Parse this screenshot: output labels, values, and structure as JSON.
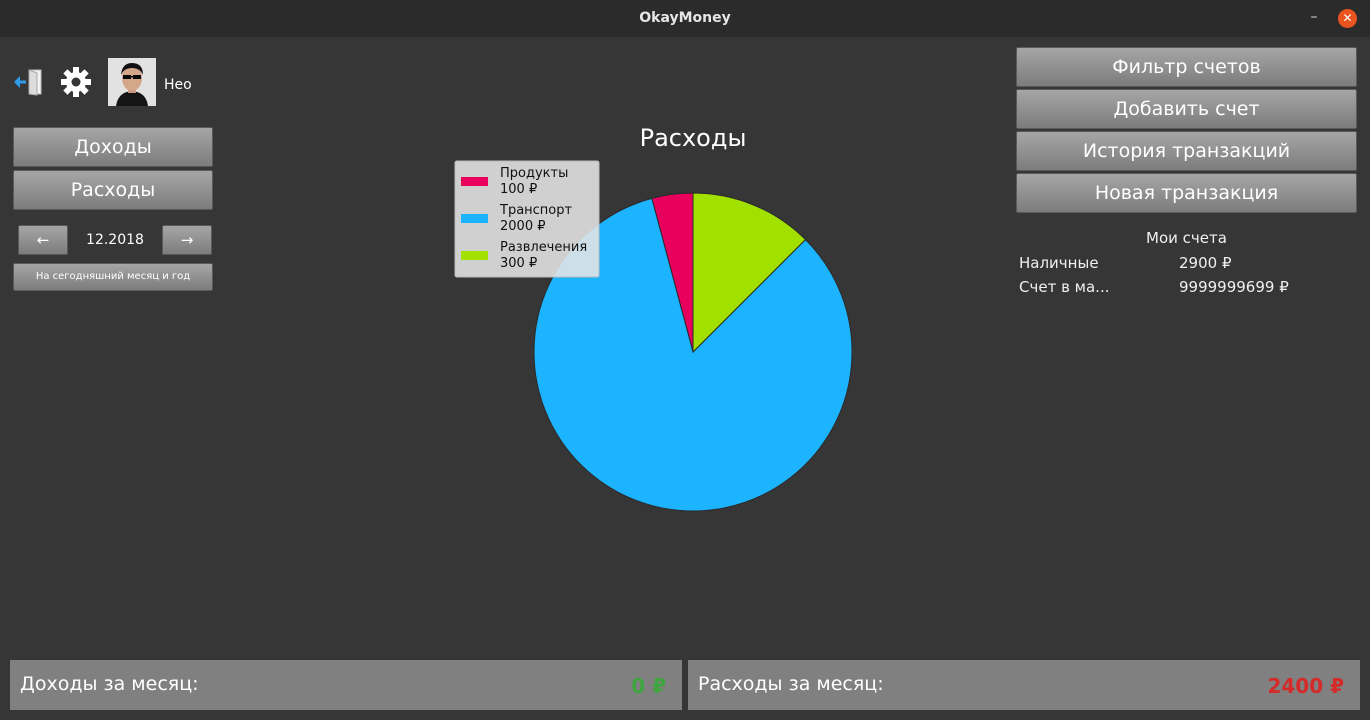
{
  "window": {
    "title": "OkayMoney",
    "minimize_glyph": "–",
    "close_glyph": "✕"
  },
  "user": {
    "name": "Нео",
    "avatar": "avatar-photo"
  },
  "icons": {
    "exit": "exit-door-icon",
    "settings": "gear-icon"
  },
  "left_nav": {
    "income_label": "Доходы",
    "expenses_label": "Расходы",
    "prev_label": "←",
    "next_label": "→",
    "period": "12.2018",
    "current_month_label": "На сегодняшний месяц и год"
  },
  "right_actions": {
    "filter_label": "Фильтр счетов",
    "add_account_label": "Добавить счет",
    "history_label": "История транзакций",
    "new_transaction_label": "Новая транзакция"
  },
  "accounts": {
    "heading": "Мои счета",
    "items": [
      {
        "name": "Наличные",
        "balance": "2900 ₽"
      },
      {
        "name": "Счет в ма...",
        "balance": "9999999699 ₽"
      }
    ]
  },
  "chart_data": {
    "type": "pie",
    "title": "Расходы",
    "slices": [
      {
        "label": "Продукты",
        "value": 100,
        "value_text": "100 ₽",
        "color": "#e8005c"
      },
      {
        "label": "Транспорт",
        "value": 2000,
        "value_text": "2000 ₽",
        "color": "#1cb4ff"
      },
      {
        "label": "Развлечения",
        "value": 300,
        "value_text": "300 ₽",
        "color": "#a2e000"
      }
    ],
    "legend_position": "top-left"
  },
  "summary": {
    "income_label": "Доходы за месяц:",
    "income_value": "0 ₽",
    "income_color": "#3fa63f",
    "expenses_label": "Расходы за месяц:",
    "expenses_value": "2400 ₽",
    "expenses_color": "#d42a2a"
  }
}
